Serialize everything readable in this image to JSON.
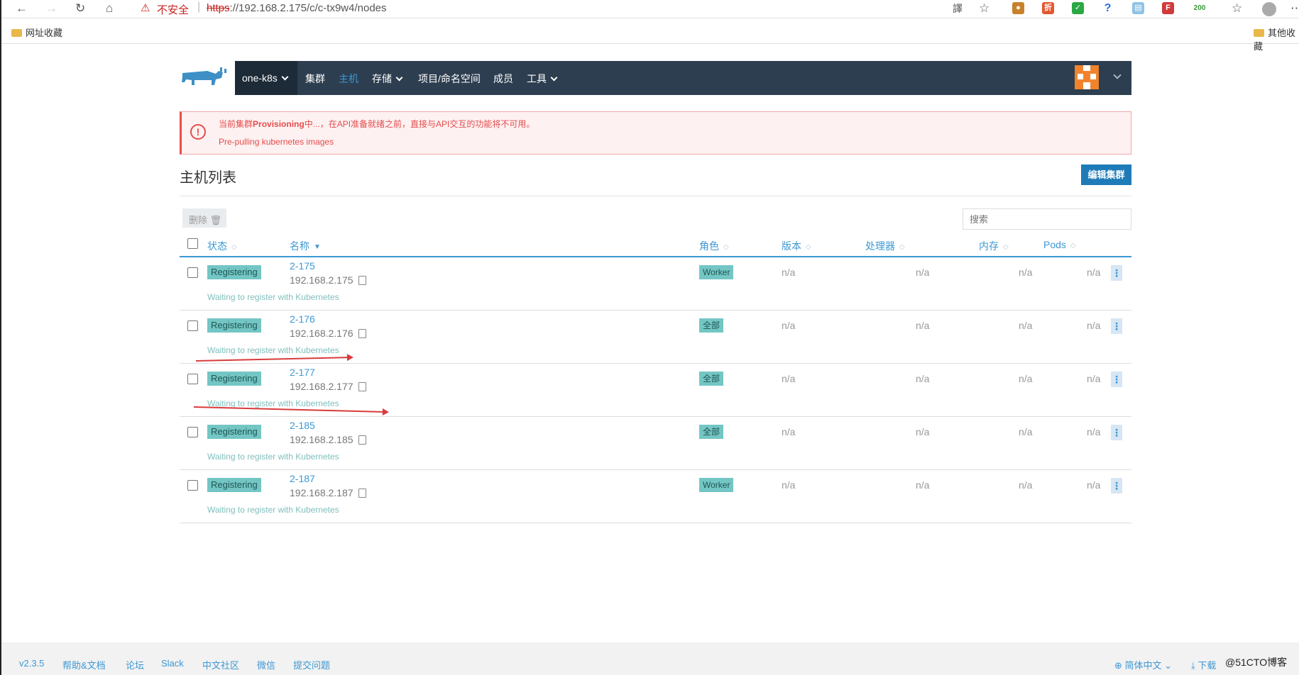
{
  "browser": {
    "warning_icon": "⚠",
    "insecure_label": "不安全",
    "url_scheme": "https",
    "url_rest": "://192.168.2.175/c/c-tx9w4/nodes",
    "badge_count": "200",
    "bookmarks_left": "网址收藏",
    "bookmarks_right": "其他收藏"
  },
  "header": {
    "cluster": "one-k8s",
    "nav": [
      "集群",
      "主机",
      "存储",
      "项目/命名空间",
      "成员",
      "工具"
    ],
    "active": "主机"
  },
  "alert": {
    "prefix": "当前集群",
    "state": "Provisioning",
    "suffix": "中...，在API准备就绪之前，直接与API交互的功能将不可用。",
    "detail": "Pre-pulling kubernetes images"
  },
  "page": {
    "title": "主机列表",
    "edit_button": "编辑集群",
    "delete_button": "删除",
    "search_placeholder": "搜索"
  },
  "table": {
    "columns": [
      "状态",
      "名称",
      "角色",
      "版本",
      "处理器",
      "内存",
      "Pods"
    ],
    "rows": [
      {
        "status": "Registering",
        "name": "2-175",
        "ip": "192.168.2.175",
        "role": "Worker",
        "version": "n/a",
        "cpu": "n/a",
        "memory": "n/a",
        "pods": "n/a",
        "message": "Waiting to register with Kubernetes"
      },
      {
        "status": "Registering",
        "name": "2-176",
        "ip": "192.168.2.176",
        "role": "全部",
        "version": "n/a",
        "cpu": "n/a",
        "memory": "n/a",
        "pods": "n/a",
        "message": "Waiting to register with Kubernetes"
      },
      {
        "status": "Registering",
        "name": "2-177",
        "ip": "192.168.2.177",
        "role": "全部",
        "version": "n/a",
        "cpu": "n/a",
        "memory": "n/a",
        "pods": "n/a",
        "message": "Waiting to register with Kubernetes"
      },
      {
        "status": "Registering",
        "name": "2-185",
        "ip": "192.168.2.185",
        "role": "全部",
        "version": "n/a",
        "cpu": "n/a",
        "memory": "n/a",
        "pods": "n/a",
        "message": "Waiting to register with Kubernetes"
      },
      {
        "status": "Registering",
        "name": "2-187",
        "ip": "192.168.2.187",
        "role": "Worker",
        "version": "n/a",
        "cpu": "n/a",
        "memory": "n/a",
        "pods": "n/a",
        "message": "Waiting to register with Kubernetes"
      }
    ]
  },
  "footer": {
    "version": "v2.3.5",
    "links": [
      "帮助&文档",
      "论坛",
      "Slack",
      "中文社区",
      "微信",
      "提交问题"
    ],
    "language": "简体中文",
    "download": "下载",
    "watermark": "@51CTO博客"
  },
  "colors": {
    "header_bg": "#2d3e50",
    "accent": "#3d98d3",
    "badge_bg": "#73c6c4",
    "alert": "#e54c4c",
    "primary_button": "#1e7bb8"
  }
}
